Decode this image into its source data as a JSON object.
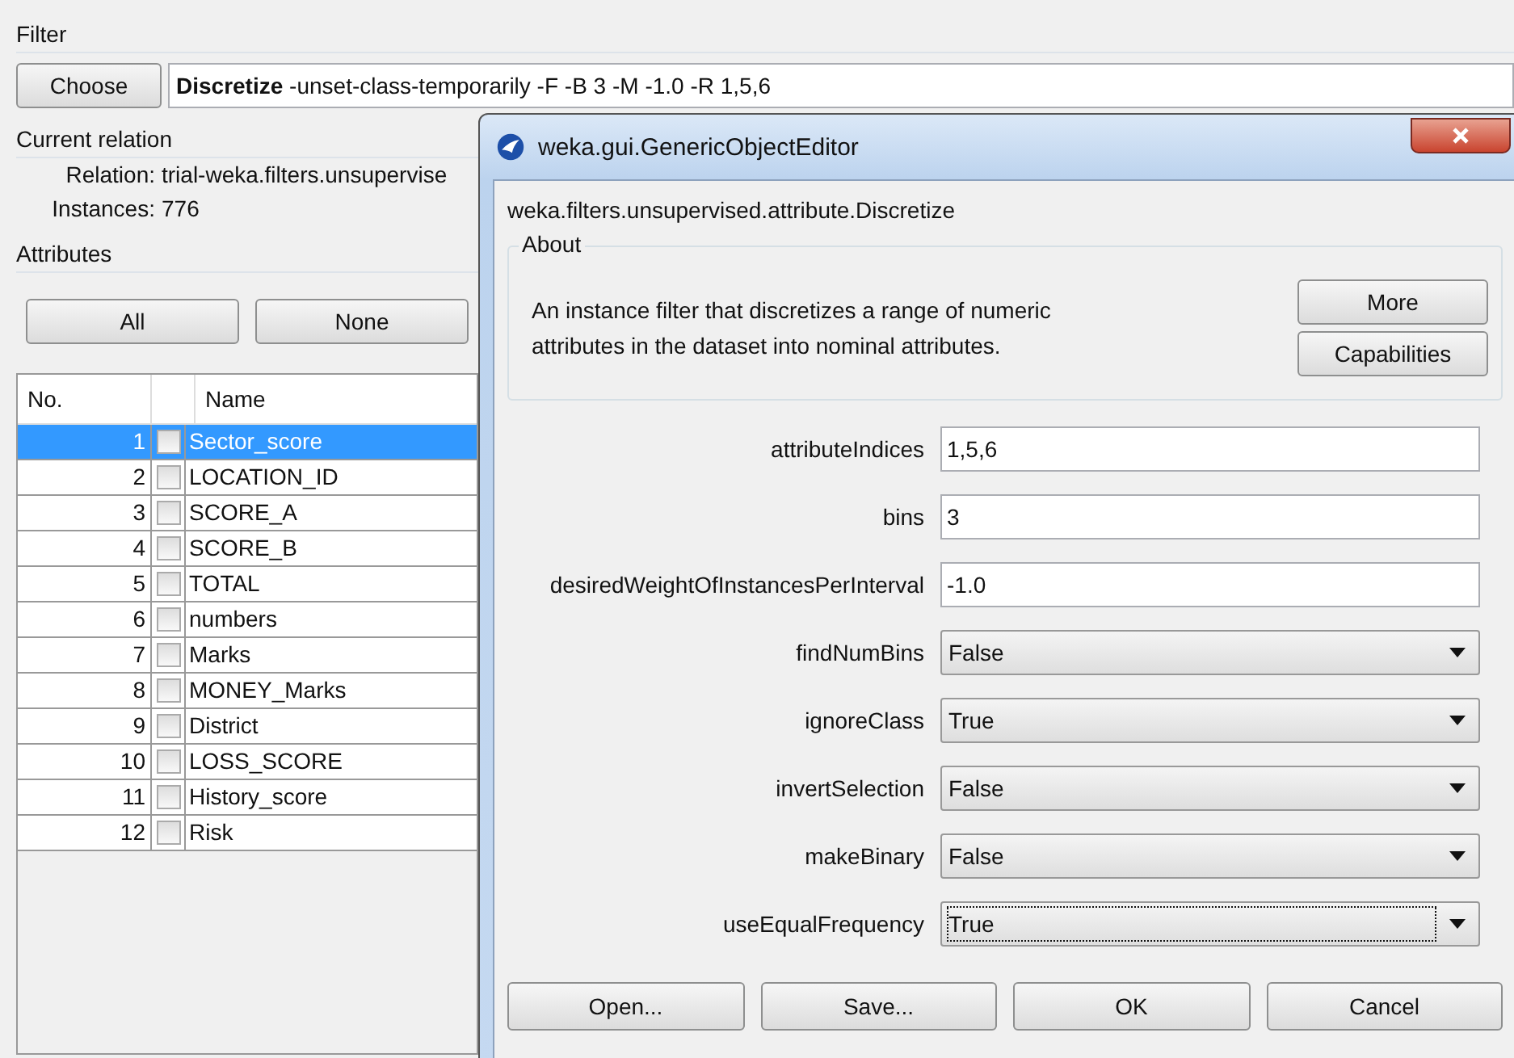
{
  "filter": {
    "label": "Filter",
    "choose_button": "Choose",
    "command_name": "Discretize",
    "command_args": "-unset-class-temporarily -F -B 3 -M -1.0 -R 1,5,6"
  },
  "current_relation": {
    "label": "Current relation",
    "relation_label": "Relation:",
    "relation": "trial-weka.filters.unsupervise",
    "instances_label": "Instances:",
    "instances": "776"
  },
  "attributes": {
    "label": "Attributes",
    "buttons": [
      "All",
      "None"
    ],
    "columns": [
      "No.",
      "Name"
    ],
    "rows": [
      {
        "no": "1",
        "name": "Sector_score",
        "checked": false,
        "selected": true
      },
      {
        "no": "2",
        "name": "LOCATION_ID",
        "checked": false,
        "selected": false
      },
      {
        "no": "3",
        "name": "SCORE_A",
        "checked": false,
        "selected": false
      },
      {
        "no": "4",
        "name": "SCORE_B",
        "checked": false,
        "selected": false
      },
      {
        "no": "5",
        "name": "TOTAL",
        "checked": false,
        "selected": false
      },
      {
        "no": "6",
        "name": "numbers",
        "checked": false,
        "selected": false
      },
      {
        "no": "7",
        "name": "Marks",
        "checked": false,
        "selected": false
      },
      {
        "no": "8",
        "name": "MONEY_Marks",
        "checked": false,
        "selected": false
      },
      {
        "no": "9",
        "name": "District",
        "checked": false,
        "selected": false
      },
      {
        "no": "10",
        "name": "LOSS_SCORE",
        "checked": false,
        "selected": false
      },
      {
        "no": "11",
        "name": "History_score",
        "checked": false,
        "selected": false
      },
      {
        "no": "12",
        "name": "Risk",
        "checked": false,
        "selected": false
      }
    ]
  },
  "dialog": {
    "title": "weka.gui.GenericObjectEditor",
    "class_name": "weka.filters.unsupervised.attribute.Discretize",
    "about": {
      "label": "About",
      "text": "An instance filter that discretizes a range of numeric attributes in the dataset into nominal attributes.",
      "buttons": [
        "More",
        "Capabilities"
      ]
    },
    "properties": [
      {
        "label": "attributeIndices",
        "kind": "text",
        "value": "1,5,6"
      },
      {
        "label": "bins",
        "kind": "text",
        "value": "3"
      },
      {
        "label": "desiredWeightOfInstancesPerInterval",
        "kind": "text",
        "value": "-1.0"
      },
      {
        "label": "findNumBins",
        "kind": "dropdown",
        "value": "False",
        "focused": false
      },
      {
        "label": "ignoreClass",
        "kind": "dropdown",
        "value": "True",
        "focused": false
      },
      {
        "label": "invertSelection",
        "kind": "dropdown",
        "value": "False",
        "focused": false
      },
      {
        "label": "makeBinary",
        "kind": "dropdown",
        "value": "False",
        "focused": false
      },
      {
        "label": "useEqualFrequency",
        "kind": "dropdown",
        "value": "True",
        "focused": true
      }
    ],
    "buttons": [
      "Open...",
      "Save...",
      "OK",
      "Cancel"
    ]
  }
}
